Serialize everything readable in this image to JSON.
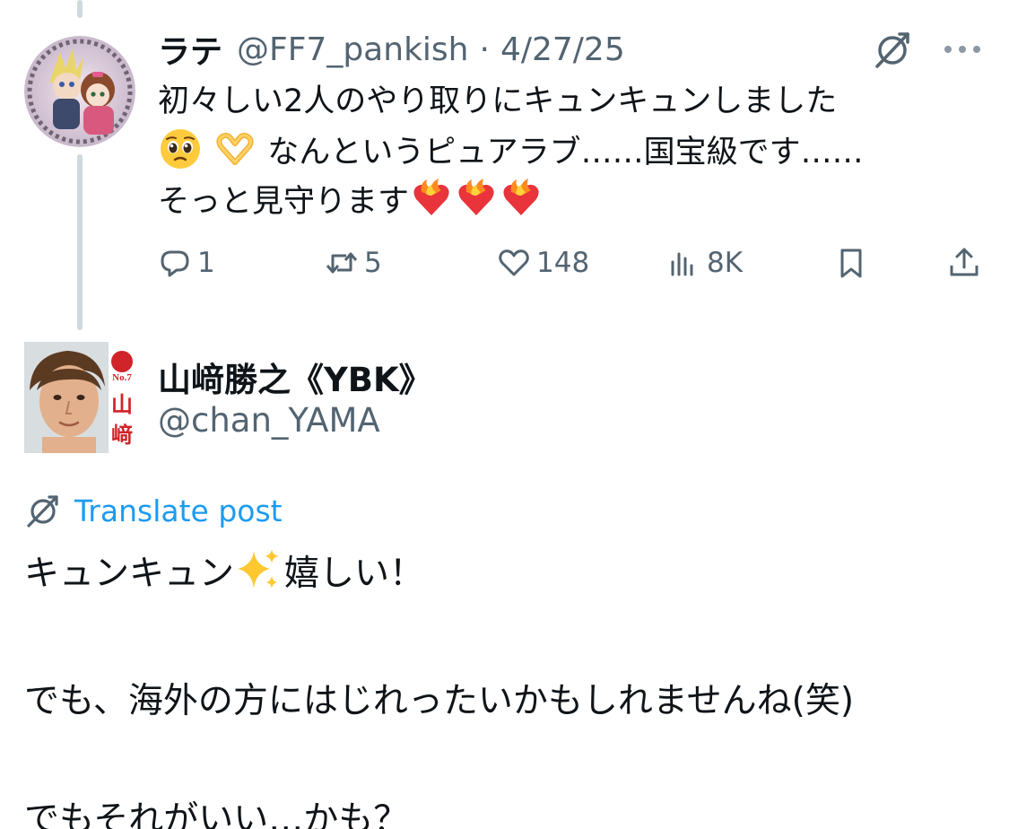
{
  "reply_to_tweet": {
    "display_name": "ラテ",
    "handle": "@FF7_pankish",
    "separator": "·",
    "date": "4/27/25",
    "body_lines": [
      "初々しい2人のやり取りにキュンキュンしました",
      "なんというピュアラブ……国宝級です……",
      "そっと見守ります"
    ],
    "emojis": {
      "line2_leading": [
        "pleading-face-emoji",
        "heart-hands-emoji"
      ],
      "line3_trailing": [
        "heart-on-fire-emoji",
        "heart-on-fire-emoji",
        "heart-on-fire-emoji"
      ]
    },
    "actions": {
      "replies": "1",
      "reposts": "5",
      "likes": "148",
      "views": "8K"
    },
    "icons": [
      "translate-icon",
      "more-icon",
      "reply-icon",
      "repost-icon",
      "like-icon",
      "views-icon",
      "bookmark-icon",
      "share-icon"
    ]
  },
  "main_tweet": {
    "display_name": "山﨑勝之《YBK》",
    "handle": "@chan_YAMA",
    "translate_label": "Translate post",
    "body_line1_text": "キュンキュン",
    "body_line1_after": "嬉しい！",
    "body_line1_emoji": "sparkles-emoji",
    "body_line2": "でも、海外の方にはじれったいかもしれませんね(笑)",
    "body_line3": "でもそれがいい…かも？"
  },
  "colors": {
    "text": "#0f1419",
    "secondary": "#536471",
    "link": "#1d9bf0",
    "thread_line": "#cfd9de"
  }
}
